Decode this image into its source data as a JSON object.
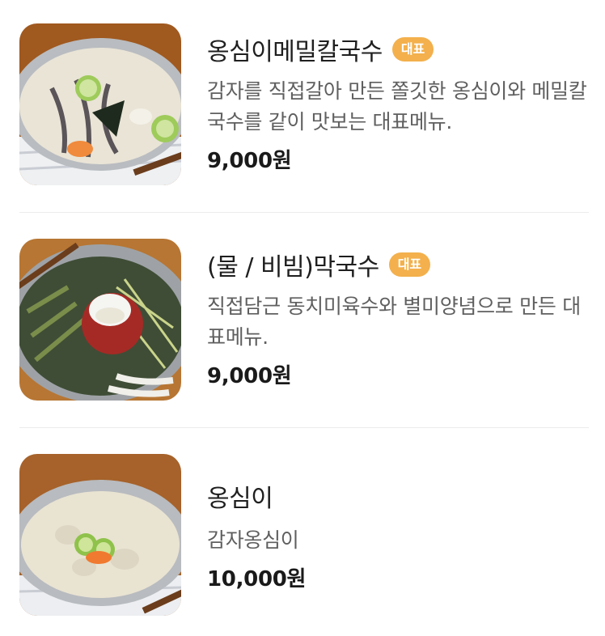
{
  "menu": {
    "items": [
      {
        "name": "옹심이메밀칼국수",
        "badge": "대표",
        "description": "감자를 직접갈아 만든 쫄깃한 옹심이와 메밀칼국수를 같이 맛보는 대표메뉴.",
        "price": "9,000원",
        "image": "ongsimi-buckwheat-kalguksu-photo"
      },
      {
        "name": "(물 / 비빔)막국수",
        "badge": "대표",
        "description": "직접담근 동치미육수와 별미양념으로 만든 대표메뉴.",
        "price": "9,000원",
        "image": "makguksu-photo"
      },
      {
        "name": "옹심이",
        "description": "감자옹심이",
        "price": "10,000원",
        "image": "ongsimi-photo"
      }
    ]
  },
  "colors": {
    "badge_bg": "#f3b04c",
    "title": "#1f1f1f",
    "description": "#5f5f5f",
    "price": "#1a1a1a",
    "divider": "#ececec"
  }
}
